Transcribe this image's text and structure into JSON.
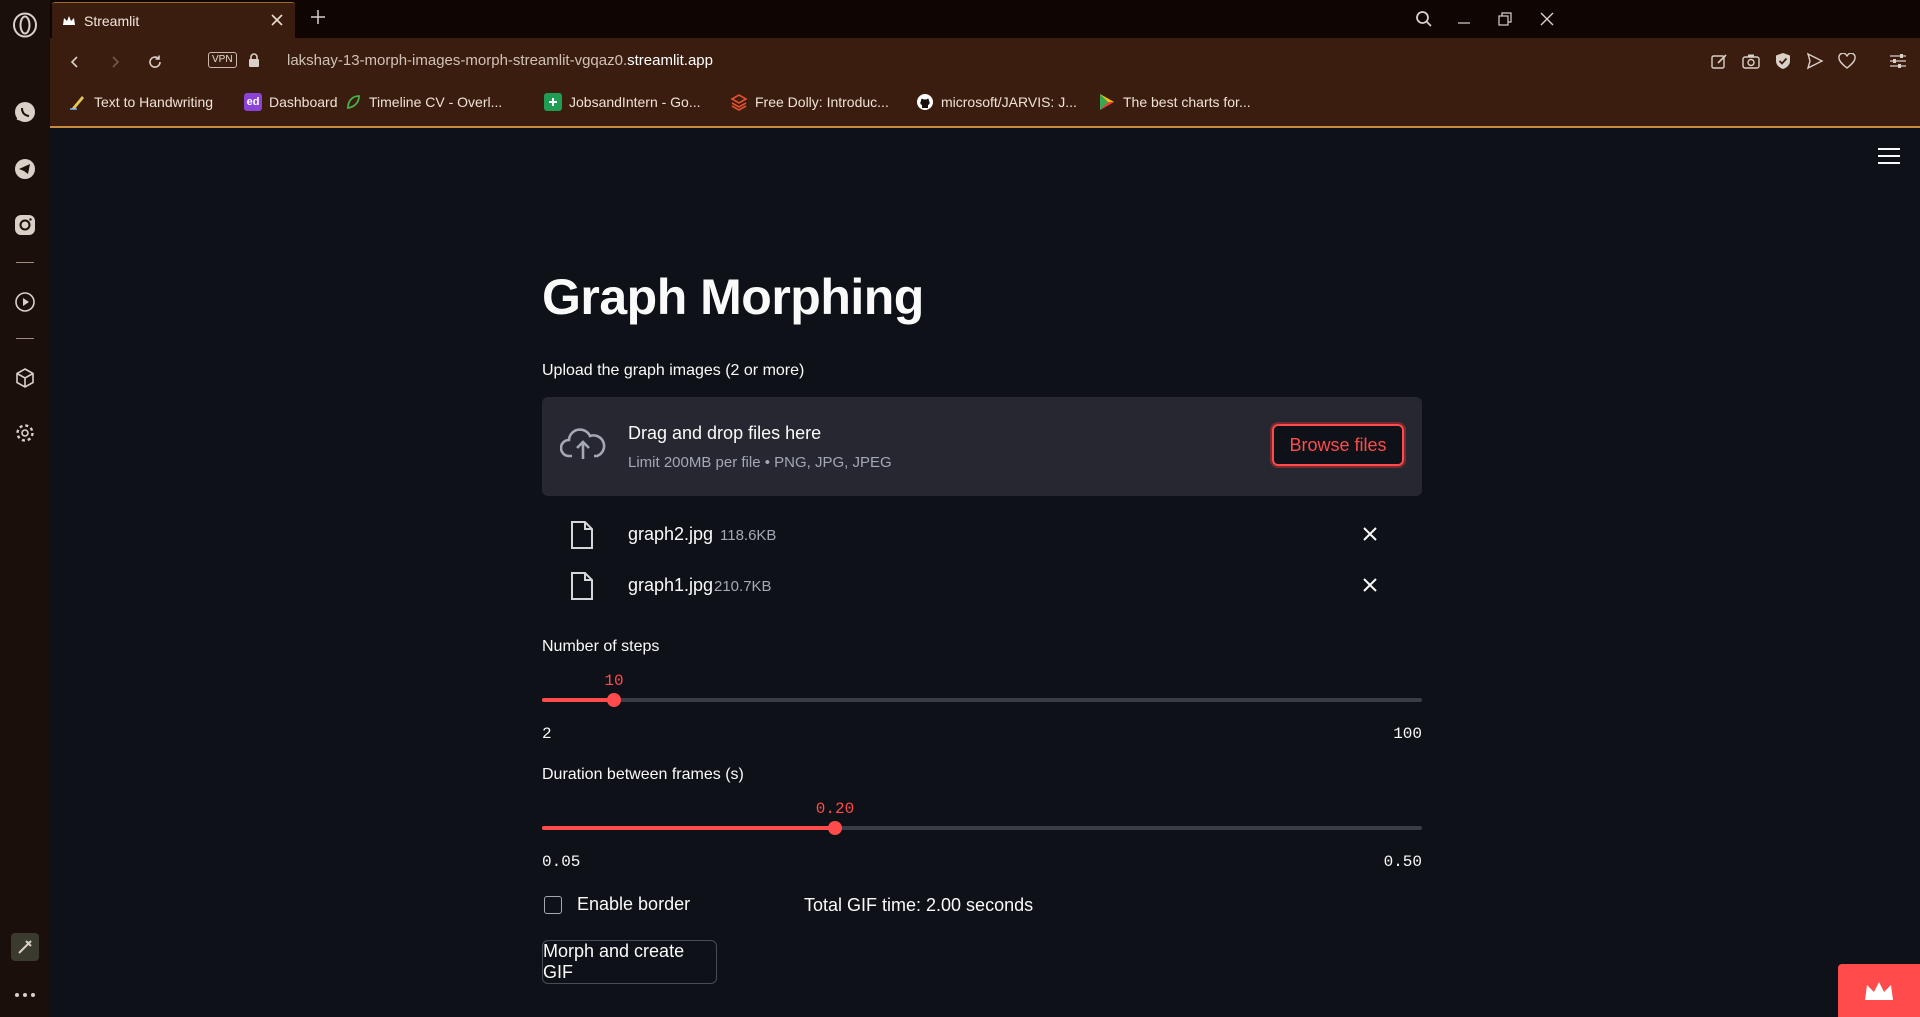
{
  "browser": {
    "tab_title": "Streamlit",
    "vpn_label": "VPN",
    "url_prefix": "lakshay-13-morph-images-morph-streamlit-vgqaz0.",
    "url_domain": "streamlit.app",
    "bookmarks": [
      {
        "label": "Text to Handwriting",
        "icon": "pen-icon",
        "color": "#e6c85a"
      },
      {
        "label": "Dashboard",
        "icon": "ed-icon",
        "color": "#8a43d6",
        "text": "ed"
      },
      {
        "label": "Timeline CV - Overl...",
        "icon": "leaf-icon",
        "color": "#48b04a"
      },
      {
        "label": "JobsandIntern - Go...",
        "icon": "sheets-icon",
        "color": "#1f9d55"
      },
      {
        "label": "Free Dolly: Introduc...",
        "icon": "databricks-icon",
        "color": "#e4512d"
      },
      {
        "label": "microsoft/JARVIS: J...",
        "icon": "github-icon",
        "color": "#ffffff"
      },
      {
        "label": "The best charts for...",
        "icon": "play-store-icon",
        "color": "#4285f4"
      }
    ]
  },
  "app": {
    "title": "Graph Morphing",
    "uploader": {
      "label": "Upload the graph images (2 or more)",
      "drop_text": "Drag and drop files here",
      "limit_text": "Limit 200MB per file • PNG, JPG, JPEG",
      "browse_label": "Browse files"
    },
    "files": [
      {
        "name": "graph2.jpg",
        "size": "118.6KB"
      },
      {
        "name": "graph1.jpg",
        "size": "210.7KB"
      }
    ],
    "steps_slider": {
      "label": "Number of steps",
      "value": "10",
      "min": "2",
      "max": "100",
      "fraction": 0.0816
    },
    "duration_slider": {
      "label": "Duration between frames (s)",
      "value": "0.20",
      "min": "0.05",
      "max": "0.50",
      "fraction": 0.3333
    },
    "border_checkbox": {
      "label": "Enable border",
      "checked": false
    },
    "total_time": "Total GIF time: 2.00 seconds",
    "morph_button": "Morph and create GIF"
  },
  "colors": {
    "accent": "#ff4b4b",
    "background": "#0e1117",
    "surface": "#262730"
  }
}
